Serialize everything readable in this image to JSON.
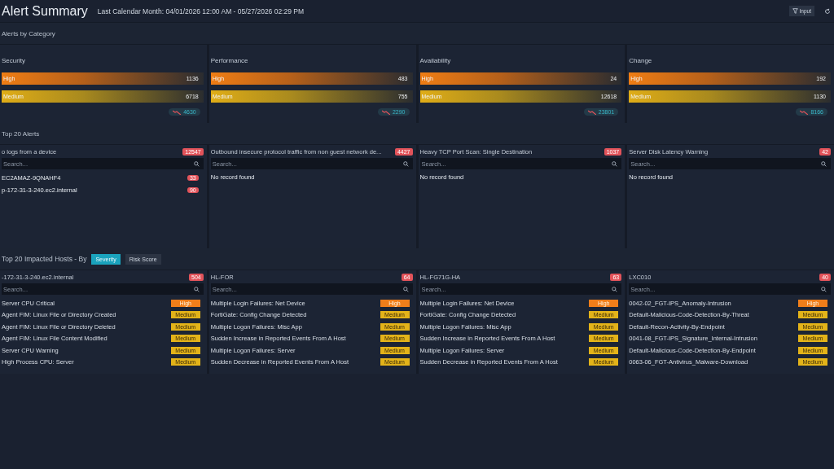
{
  "header": {
    "title": "Alert Summary",
    "range": "Last Calendar Month: 04/01/2026 12:00 AM - 05/27/2026 02:29 PM",
    "input_button": "Input"
  },
  "categories": {
    "title": "Alerts by Category",
    "cards": [
      {
        "name": "Security",
        "bars": [
          {
            "kind": "high",
            "label": "High",
            "value": "1136"
          },
          {
            "kind": "medium",
            "label": "Medium",
            "value": "6718"
          }
        ],
        "trend": "4630"
      },
      {
        "name": "Performance",
        "bars": [
          {
            "kind": "high",
            "label": "High",
            "value": "483"
          },
          {
            "kind": "medium",
            "label": "Medium",
            "value": "755"
          }
        ],
        "trend": "2290"
      },
      {
        "name": "Availability",
        "bars": [
          {
            "kind": "high",
            "label": "High",
            "value": "24"
          },
          {
            "kind": "medium",
            "label": "Medium",
            "value": "12618"
          }
        ],
        "trend": "23801"
      },
      {
        "name": "Change",
        "bars": [
          {
            "kind": "high",
            "label": "High",
            "value": "192"
          },
          {
            "kind": "medium",
            "label": "Medium",
            "value": "1130"
          }
        ],
        "trend": "8166"
      }
    ]
  },
  "top_alerts": {
    "title": "Top 20 Alerts",
    "cards": [
      {
        "name": "o logs from a device",
        "count": "12547",
        "search": {
          "placeholder": "Search..."
        },
        "items": [
          {
            "name": "EC2AMAZ-9QNAHF4",
            "count": "33"
          },
          {
            "name": "p-172-31-3-240.ec2.internal",
            "count": "90"
          }
        ]
      },
      {
        "name": "Outbound insecure protocol traffic from non guest network de...",
        "count": "4427",
        "search": {
          "placeholder": "Search..."
        },
        "empty": "No record found"
      },
      {
        "name": "Heavy TCP Port Scan: Single Destination",
        "count": "1037",
        "search": {
          "placeholder": "Search..."
        },
        "empty": "No record found"
      },
      {
        "name": "Server Disk Latency Warning",
        "count": "42",
        "search": {
          "placeholder": "Search..."
        },
        "empty": "No record found"
      }
    ]
  },
  "hosts": {
    "title": "Top 20 Impacted Hosts - By",
    "toggles": [
      {
        "label": "Severity",
        "selected": true
      },
      {
        "label": "Risk Score",
        "selected": false
      }
    ],
    "cards": [
      {
        "name": "-172-31-3-240.ec2.internal",
        "count": "504",
        "search": {
          "placeholder": "Search..."
        },
        "rows": [
          {
            "name": "Server CPU Critical",
            "kind": "high",
            "severity": "High"
          },
          {
            "name": "Agent FIM: Linux File or Directory Created",
            "kind": "medium",
            "severity": "Medium"
          },
          {
            "name": "Agent FIM: Linux File or Directory Deleted",
            "kind": "medium",
            "severity": "Medium"
          },
          {
            "name": "Agent FIM: Linux File Content Modified",
            "kind": "medium",
            "severity": "Medium"
          },
          {
            "name": "Server CPU Warning",
            "kind": "medium",
            "severity": "Medium"
          },
          {
            "name": "High Process CPU: Server",
            "kind": "medium",
            "severity": "Medium"
          }
        ]
      },
      {
        "name": "HL-FOR",
        "count": "64",
        "search": {
          "placeholder": "Search..."
        },
        "rows": [
          {
            "name": "Multiple Login Failures: Net Device",
            "kind": "high",
            "severity": "High"
          },
          {
            "name": "FortiGate: Config Change Detected",
            "kind": "medium",
            "severity": "Medium"
          },
          {
            "name": "Multiple Logon Failures: Misc App",
            "kind": "medium",
            "severity": "Medium"
          },
          {
            "name": "Sudden Increase in Reported Events From A Host",
            "kind": "medium",
            "severity": "Medium"
          },
          {
            "name": "Multiple Logon Failures: Server",
            "kind": "medium",
            "severity": "Medium"
          },
          {
            "name": "Sudden Decrease in Reported Events From A Host",
            "kind": "medium",
            "severity": "Medium"
          }
        ]
      },
      {
        "name": "HL-FG71G-HA",
        "count": "63",
        "search": {
          "placeholder": "Search..."
        },
        "rows": [
          {
            "name": "Multiple Login Failures: Net Device",
            "kind": "high",
            "severity": "High"
          },
          {
            "name": "FortiGate: Config Change Detected",
            "kind": "medium",
            "severity": "Medium"
          },
          {
            "name": "Multiple Logon Failures: Misc App",
            "kind": "medium",
            "severity": "Medium"
          },
          {
            "name": "Sudden Increase in Reported Events From A Host",
            "kind": "medium",
            "severity": "Medium"
          },
          {
            "name": "Multiple Logon Failures: Server",
            "kind": "medium",
            "severity": "Medium"
          },
          {
            "name": "Sudden Decrease in Reported Events From A Host",
            "kind": "medium",
            "severity": "Medium"
          }
        ]
      },
      {
        "name": "LXC010",
        "count": "40",
        "search": {
          "placeholder": "Search..."
        },
        "rows": [
          {
            "name": "0042-02_FGT-IPS_Anomaly-Intrusion",
            "kind": "high",
            "severity": "High"
          },
          {
            "name": "Default-Malicious-Code-Detection-By-Threat",
            "kind": "medium",
            "severity": "Medium"
          },
          {
            "name": "Default-Recon-Activity-By-Endpoint",
            "kind": "medium",
            "severity": "Medium"
          },
          {
            "name": "0041-08_FGT-IPS_Signature_Internal-Intrusion",
            "kind": "medium",
            "severity": "Medium"
          },
          {
            "name": "Default-Malicious-Code-Detection-By-Endpoint",
            "kind": "medium",
            "severity": "Medium"
          },
          {
            "name": "0063-06_FGT-Antivirus_Malware-Download",
            "kind": "medium",
            "severity": "Medium"
          }
        ]
      }
    ]
  }
}
